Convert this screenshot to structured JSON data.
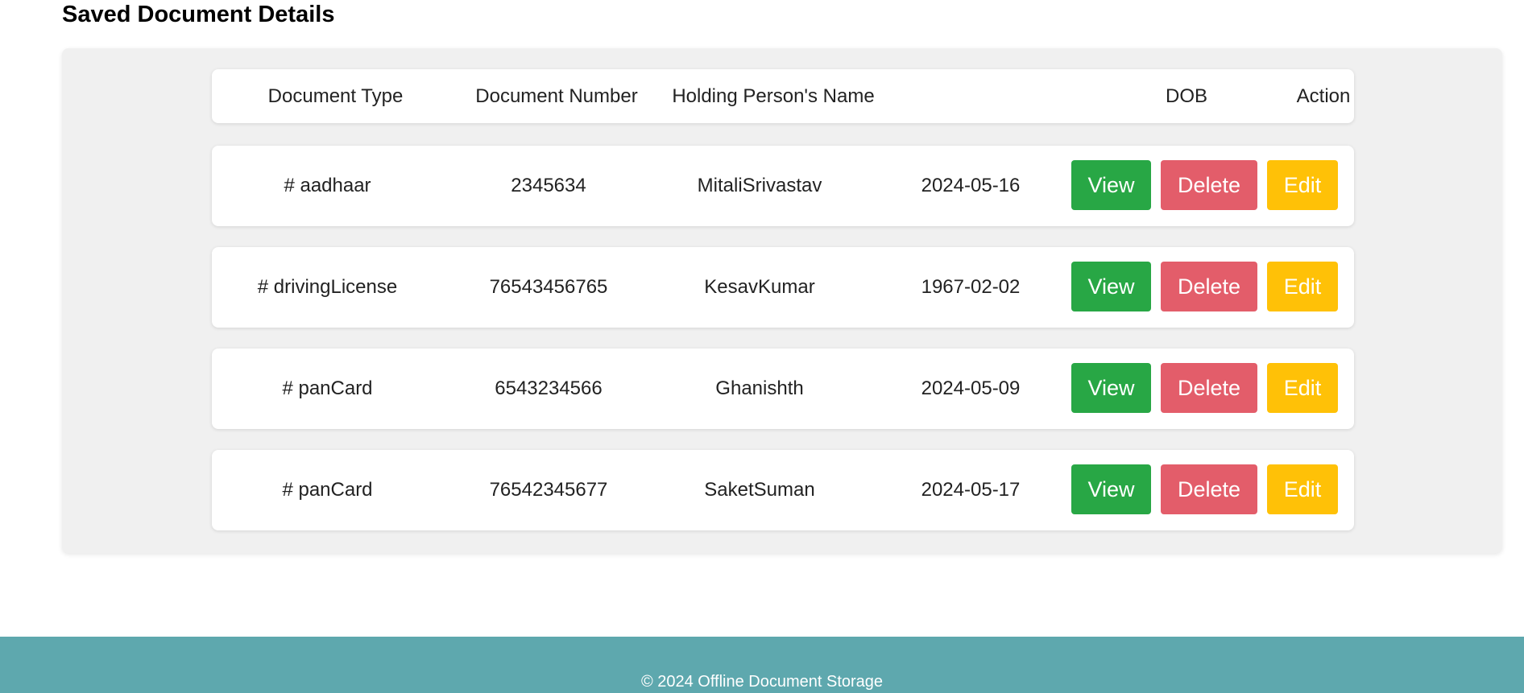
{
  "page": {
    "title": "Saved Document Details"
  },
  "table": {
    "headers": {
      "document_type": "Document Type",
      "document_number": "Document Number",
      "holder_name": "Holding Person's Name",
      "dob": "DOB",
      "action": "Action"
    },
    "rows": [
      {
        "type": "# aadhaar",
        "number": "2345634",
        "name": "MitaliSrivastav",
        "dob": "2024-05-16"
      },
      {
        "type": "# drivingLicense",
        "number": "76543456765",
        "name": "KesavKumar",
        "dob": "1967-02-02"
      },
      {
        "type": "# panCard",
        "number": "6543234566",
        "name": "Ghanishth",
        "dob": "2024-05-09"
      },
      {
        "type": "# panCard",
        "number": "76542345677",
        "name": "SaketSuman",
        "dob": "2024-05-17"
      }
    ],
    "actions": {
      "view": "View",
      "delete": "Delete",
      "edit": "Edit"
    }
  },
  "footer": {
    "text": "© 2024 Offline Document Storage"
  },
  "colors": {
    "view": "#28a745",
    "delete": "#e35d6a",
    "edit": "#ffc107",
    "footer_bg": "#5ea8ae",
    "panel_bg": "#f0f0f0"
  }
}
